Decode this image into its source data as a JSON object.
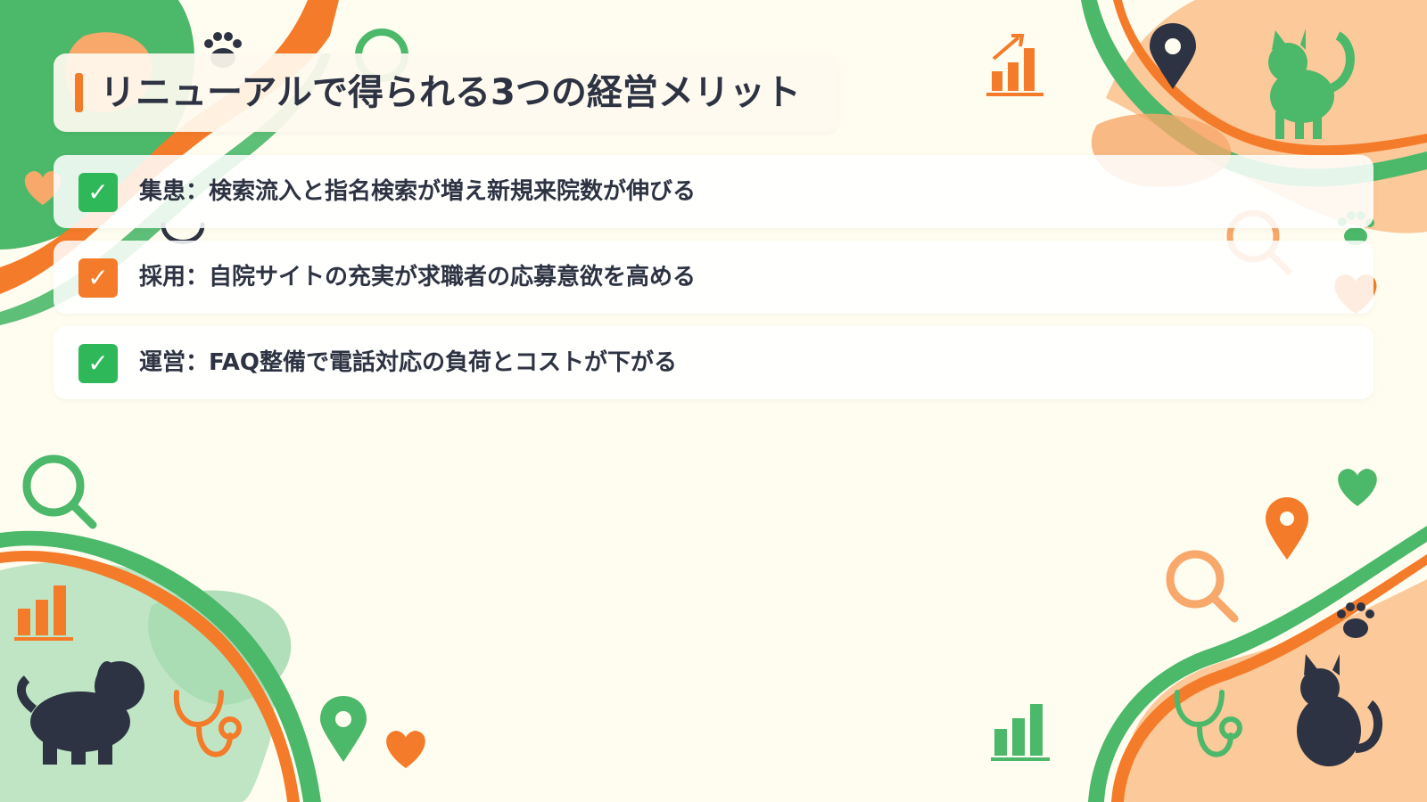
{
  "title": "リニューアルで得られる3つの経営メリット",
  "items": [
    {
      "text": "集患：検索流入と指名検索が増え新規来院数が伸びる",
      "check": "✓",
      "color": "green"
    },
    {
      "text": "採用：自院サイトの充実が求職者の応募意欲を高める",
      "check": "✓",
      "color": "orange"
    },
    {
      "text": "運営：FAQ整備で電話対応の負荷とコストが下がる",
      "check": "✓",
      "color": "green"
    }
  ],
  "colors": {
    "green": "#2fb85a",
    "orange": "#f47b29",
    "dark": "#2d3342",
    "background": "#fffdf0"
  },
  "icons": [
    "paw-icon",
    "dog-icon",
    "cat-icon",
    "heart-icon",
    "magnifier-icon",
    "stethoscope-icon",
    "map-pin-icon",
    "bar-chart-icon",
    "growth-chart-icon"
  ]
}
